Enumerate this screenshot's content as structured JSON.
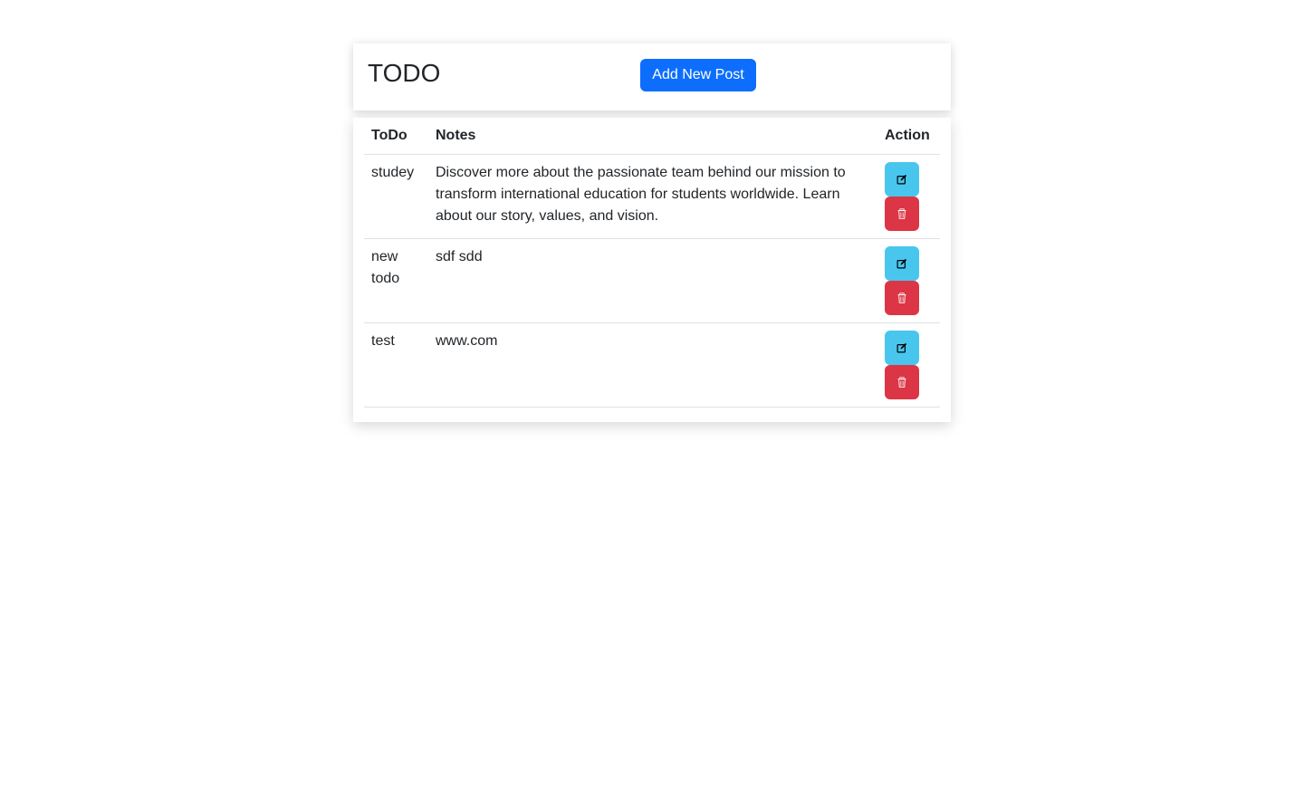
{
  "header": {
    "title": "TODO",
    "add_button_label": "Add New Post"
  },
  "table": {
    "columns": [
      "ToDo",
      "Notes",
      "Action"
    ],
    "rows": [
      {
        "todo": "studey",
        "notes": "Discover more about the passionate team behind our mission to transform international education for students worldwide. Learn about our story, values, and vision."
      },
      {
        "todo": "new todo",
        "notes": "sdf sdd"
      },
      {
        "todo": "test",
        "notes": "www.com"
      }
    ]
  },
  "icons": {
    "edit": "edit-square-icon",
    "delete": "trash-icon"
  },
  "colors": {
    "primary": "#0d6efd",
    "edit_button": "#48c6ee",
    "delete_button": "#dc3545"
  }
}
